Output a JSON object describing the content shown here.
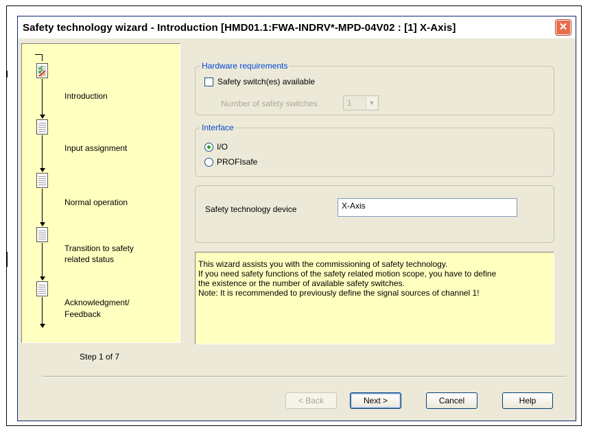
{
  "dialog": {
    "title": "Safety technology wizard - Introduction [HMD01.1:FWA-INDRV*-MPD-04V02 : [1] X-Axis]",
    "close_glyph": "✕"
  },
  "steps": [
    {
      "label_line1": "Introduction",
      "label_line2": "",
      "icon": "checklist-doc-icon"
    },
    {
      "label_line1": "Input assignment",
      "label_line2": "",
      "icon": "document-icon"
    },
    {
      "label_line1": "Normal operation",
      "label_line2": "",
      "icon": "document-icon"
    },
    {
      "label_line1": "Transition to safety",
      "label_line2": "related status",
      "icon": "document-icon"
    },
    {
      "label_line1": "Acknowledgment/",
      "label_line2": "Feedback",
      "icon": "document-icon"
    }
  ],
  "step_counter": "Step 1 of 7",
  "hardware": {
    "title": "Hardware requirements",
    "safety_switch_label": "Safety switch(es) available",
    "safety_switch_checked": false,
    "num_switches_label": "Number of safety switches",
    "num_switches_value": "1"
  },
  "interface": {
    "title": "Interface",
    "options": [
      {
        "label": "I/O",
        "selected": true
      },
      {
        "label": "PROFIsafe",
        "selected": false
      }
    ]
  },
  "device": {
    "label": "Safety technology device",
    "value": "X-Axis"
  },
  "info_lines": [
    "This wizard assists you with the commissioning of safety technology.",
    "If you need safety functions of the safety related motion scope, you have to define",
    "the existence or the number of available safety switches.",
    "Note: It is recommended to previously define the signal sources of channel 1!"
  ],
  "buttons": {
    "back": "< Back",
    "next": "Next >",
    "cancel": "Cancel",
    "help": "Help"
  },
  "colors": {
    "panel_yellow": "#ffffc0",
    "dialog_bg": "#ece9d8",
    "group_title_blue": "#0046d5",
    "close_red": "#e86d4a"
  }
}
